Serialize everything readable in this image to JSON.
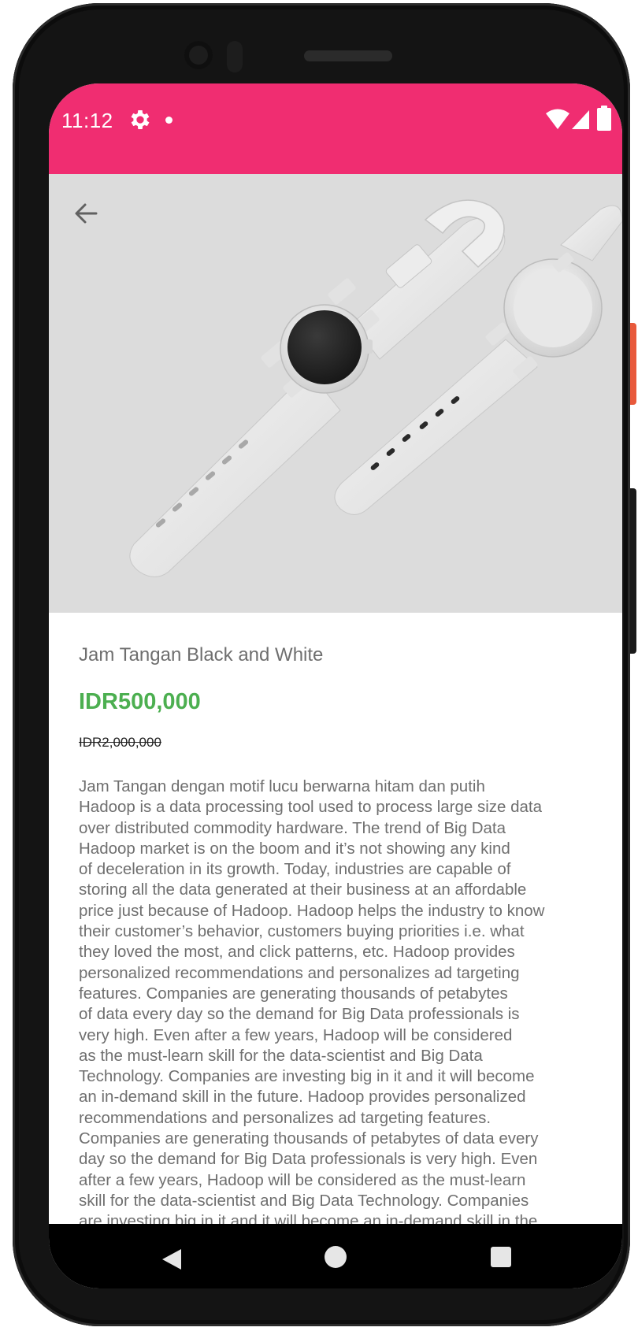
{
  "status_bar": {
    "time": "11:12",
    "settings_icon": "gear-icon",
    "notification_icon": "dot-icon",
    "wifi_icon": "wifi-icon",
    "signal_icon": "cell-signal-icon",
    "battery_icon": "battery-icon",
    "background_color": "#f02d71"
  },
  "header": {
    "back_icon": "arrow-back-icon"
  },
  "product": {
    "image_icon": "watch-image",
    "title": "Jam Tangan Black and White",
    "price": "IDR500,000",
    "original_price": "IDR2,000,000",
    "price_color": "#4caf50",
    "description": "Jam Tangan dengan motif lucu berwarna hitam dan putih\nHadoop is a data processing tool used to process large size data\nover distributed commodity hardware. The trend of Big Data\nHadoop market is on the boom and it’s not showing any kind\nof deceleration in its growth. Today, industries are capable of\nstoring all the data generated at their business at an affordable\nprice just because of Hadoop. Hadoop helps the industry to know\ntheir customer’s behavior, customers buying priorities i.e. what\nthey loved the most, and click patterns, etc. Hadoop provides\npersonalized recommendations and personalizes ad targeting\nfeatures. Companies are generating thousands of petabytes\nof data every day so the demand for Big Data professionals is\nvery high. Even after a few years, Hadoop will be considered\nas the must-learn skill for the data-scientist and Big Data\nTechnology. Companies are investing big in it and it will become\nan in-demand skill in the future. Hadoop provides personalized\nrecommendations and personalizes ad targeting features.\nCompanies are generating thousands of petabytes of data every\nday so the demand for Big Data professionals is very high. Even\nafter a few years, Hadoop will be considered as the must-learn\nskill for the data-scientist and Big Data Technology. Companies\nare investing big in it and it will become an in-demand skill in the"
  },
  "nav_bar": {
    "back_icon": "triangle-back-icon",
    "home_icon": "circle-home-icon",
    "recents_icon": "square-recents-icon"
  }
}
